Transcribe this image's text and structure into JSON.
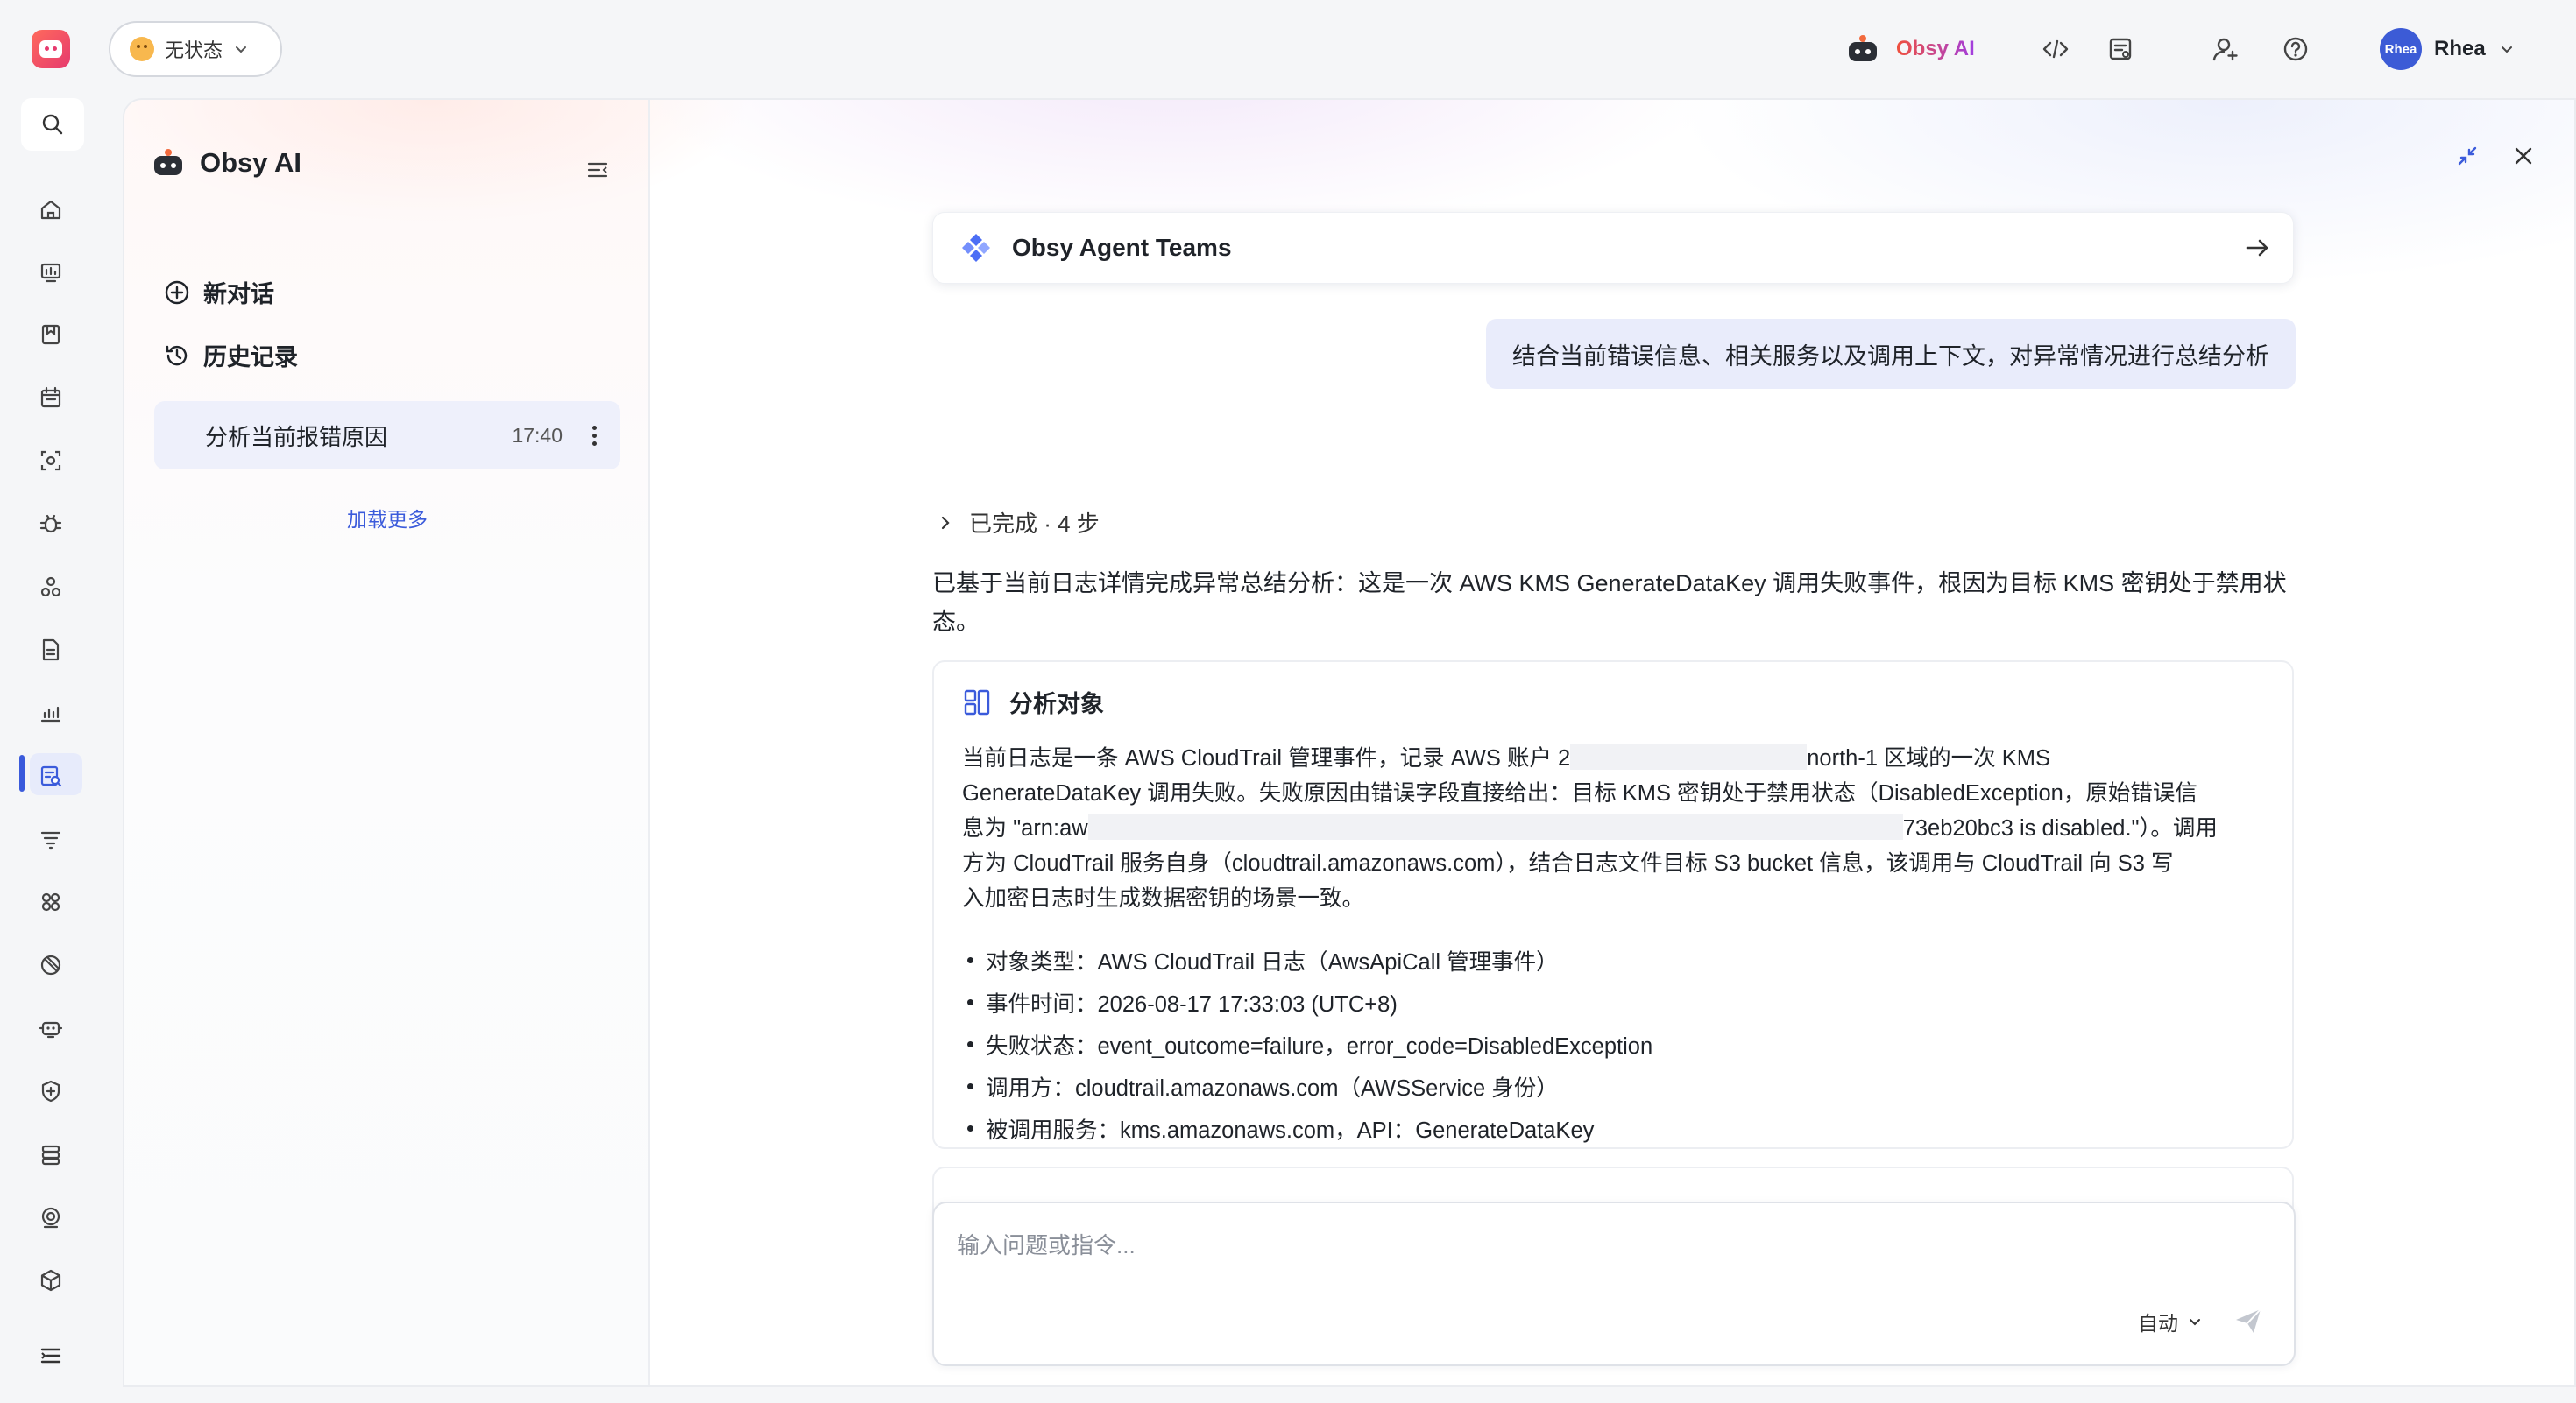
{
  "topbar": {
    "status_label": "无状态",
    "brand_label": "Obsy AI",
    "user_name": "Rhea",
    "avatar_text": "Rhea"
  },
  "sidebar": {
    "title": "Obsy AI",
    "new_chat": "新对话",
    "history": "历史记录",
    "history_items": [
      {
        "title": "分析当前报错原因",
        "time": "17:40"
      }
    ],
    "load_more": "加载更多"
  },
  "chat": {
    "agent_card_title": "Obsy Agent Teams",
    "user_message": "结合当前错误信息、相关服务以及调用上下文，对异常情况进行总结分析",
    "steps_label": "已完成 · 4 步",
    "answer_intro": "已基于当前日志详情完成异常总结分析：这是一次 AWS KMS GenerateDataKey 调用失败事件，根因为目标 KMS 密钥处于禁用状态。",
    "analysis": {
      "title": "分析对象",
      "p1a": "当前日志是一条 AWS CloudTrail 管理事件，记录 AWS 账户 2",
      "p1b": "north-1 区域的一次 KMS",
      "p2": "GenerateDataKey 调用失败。失败原因由错误字段直接给出：目标 KMS 密钥处于禁用状态（DisabledException，原始错误信",
      "p3a": "息为 \"arn:aw",
      "p3b": "73eb20bc3 is disabled.\"）。调用",
      "p4": "方为 CloudTrail 服务自身（cloudtrail.amazonaws.com），结合日志文件目标 S3 bucket 信息，该调用与 CloudTrail 向 S3 写",
      "p5": "入加密日志时生成数据密钥的场景一致。",
      "bullets": [
        "对象类型：AWS CloudTrail 日志（AwsApiCall 管理事件）",
        "事件时间：2026-08-17 17:33:03 (UTC+8)",
        "失败状态：event_outcome=failure，error_code=DisabledException",
        "调用方：cloudtrail.amazonaws.com（AWSService 身份）",
        "被调用服务：kms.amazonaws.com，API：GenerateDataKey"
      ]
    },
    "composer": {
      "placeholder": "输入问题或指令...",
      "mode": "自动"
    }
  },
  "colors": {
    "accent": "#3b5bdb",
    "user_bubble": "#e9ecfb",
    "brand_gradient_start": "#f0503c",
    "brand_gradient_end": "#a13de0"
  }
}
